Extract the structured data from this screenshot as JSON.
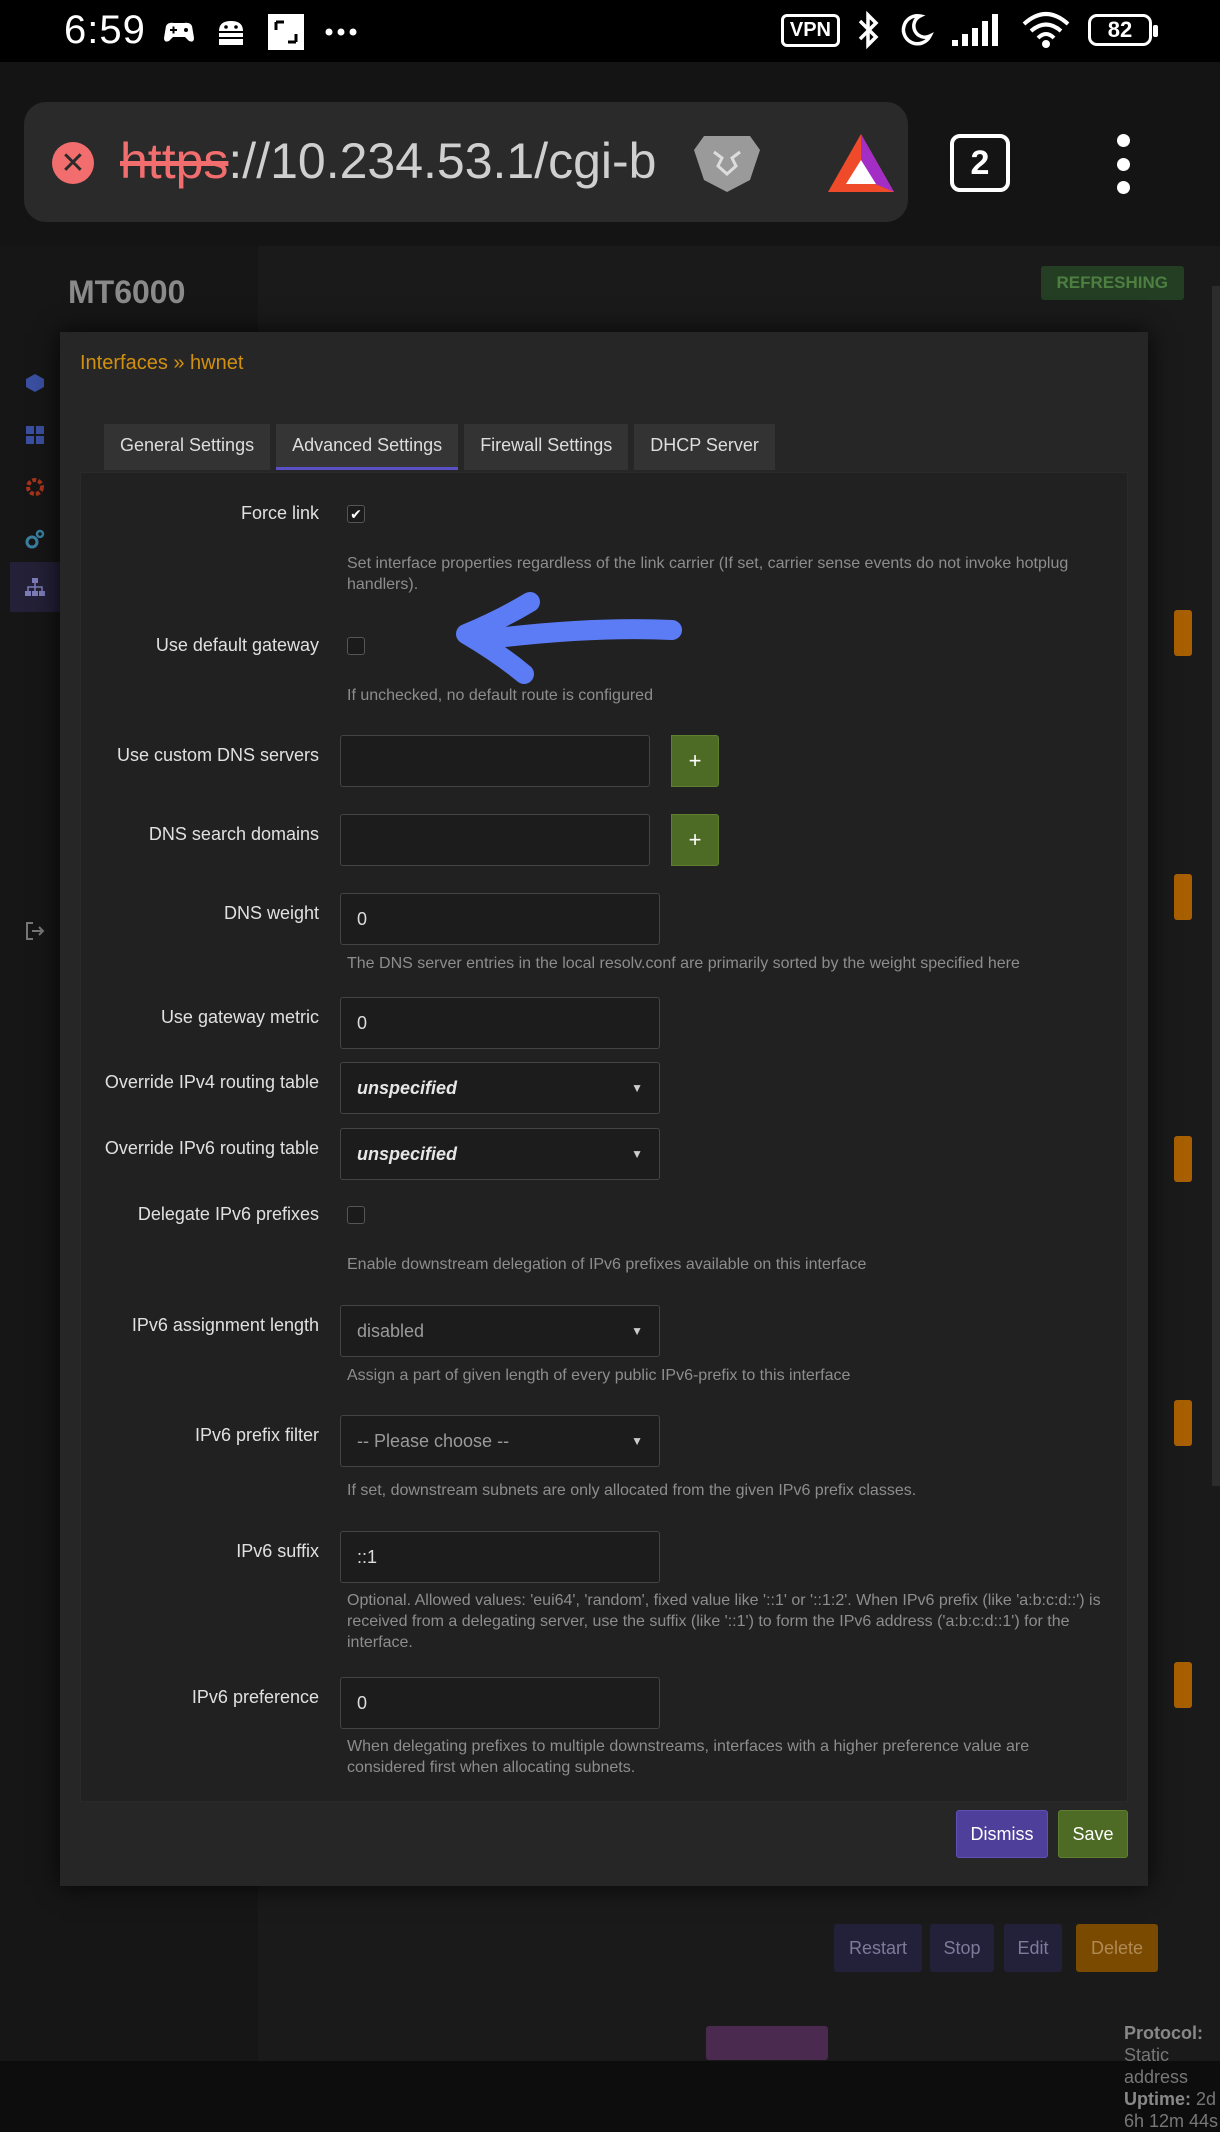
{
  "status_bar": {
    "time": "6:59",
    "left_icons": [
      "game-controller-icon",
      "android-icon",
      "screenshot-icon",
      "more-dots-icon"
    ],
    "vpn": "VPN",
    "battery": "82",
    "right_icons": [
      "bluetooth-icon",
      "moon-icon",
      "signal-icon",
      "wifi-icon"
    ]
  },
  "browser": {
    "url_scheme": "https",
    "url_rest": "://10.234.53.1/cgi-b",
    "tabs_count": "2"
  },
  "background_page": {
    "brand": "MT6000",
    "refreshing_badge": "REFRESHING",
    "buttons": {
      "restart": "Restart",
      "stop": "Stop",
      "edit": "Edit",
      "delete": "Delete"
    },
    "protocol_label": "Protocol:",
    "protocol_value": "Static address",
    "uptime_label": "Uptime:",
    "uptime_value": "2d 6h 12m 44s"
  },
  "modal": {
    "title": "Interfaces » hwnet",
    "tabs": [
      {
        "label": "General Settings",
        "active": false
      },
      {
        "label": "Advanced Settings",
        "active": true
      },
      {
        "label": "Firewall Settings",
        "active": false
      },
      {
        "label": "DHCP Server",
        "active": false
      }
    ],
    "fields": {
      "force_link": {
        "label": "Force link",
        "checked": true,
        "hint": "Set interface properties regardless of the link carrier (If set, carrier sense events do not invoke hotplug handlers)."
      },
      "default_gateway": {
        "label": "Use default gateway",
        "checked": false,
        "hint": "If unchecked, no default route is configured"
      },
      "custom_dns": {
        "label": "Use custom DNS servers",
        "value": "",
        "add": "+"
      },
      "dns_search": {
        "label": "DNS search domains",
        "value": "",
        "add": "+"
      },
      "dns_weight": {
        "label": "DNS weight",
        "value": "0",
        "hint": "The DNS server entries in the local resolv.conf are primarily sorted by the weight specified here"
      },
      "gateway_metric": {
        "label": "Use gateway metric",
        "value": "0"
      },
      "ipv4_table": {
        "label": "Override IPv4 routing table",
        "value": "unspecified"
      },
      "ipv6_table": {
        "label": "Override IPv6 routing table",
        "value": "unspecified"
      },
      "delegate_ipv6": {
        "label": "Delegate IPv6 prefixes",
        "checked": false,
        "hint": "Enable downstream delegation of IPv6 prefixes available on this interface"
      },
      "ipv6_assign_len": {
        "label": "IPv6 assignment length",
        "value": "disabled",
        "hint": "Assign a part of given length of every public IPv6-prefix to this interface"
      },
      "ipv6_prefix_filter": {
        "label": "IPv6 prefix filter",
        "value": "-- Please choose --",
        "hint": "If set, downstream subnets are only allocated from the given IPv6 prefix classes."
      },
      "ipv6_suffix": {
        "label": "IPv6 suffix",
        "value": "::1",
        "hint": "Optional. Allowed values: 'eui64', 'random', fixed value like '::1' or '::1:2'. When IPv6 prefix (like 'a:b:c:d::') is received from a delegating server, use the suffix (like '::1') to form the IPv6 address ('a:b:c:d::1') for the interface."
      },
      "ipv6_pref": {
        "label": "IPv6 preference",
        "value": "0",
        "hint": "When delegating prefixes to multiple downstreams, interfaces with a higher preference value are considered first when allocating subnets."
      }
    },
    "dismiss": "Dismiss",
    "save": "Save"
  },
  "colors": {
    "accent_title": "#d29010",
    "tab_underline": "#5b4fc6",
    "save_green": "#4e6b26",
    "dismiss_purple": "#4d3f9a",
    "annotation_arrow": "#5b7cf5"
  }
}
